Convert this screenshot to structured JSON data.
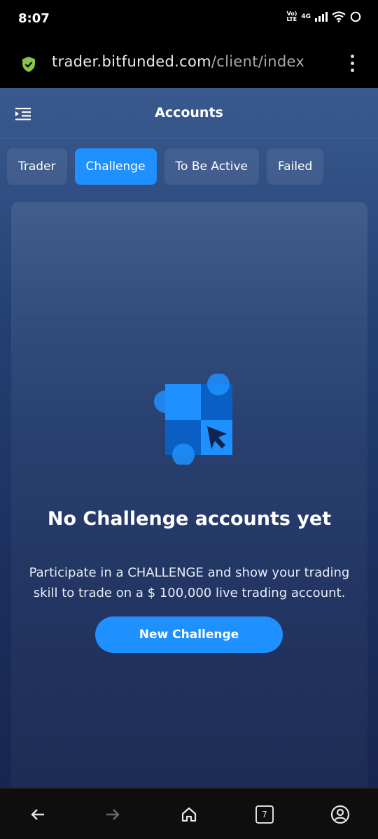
{
  "status_bar": {
    "time": "8:07",
    "volte_top": "Vo)",
    "volte_bottom": "LTE",
    "network": "4G"
  },
  "browser": {
    "url_domain": "trader.bitfunded.com",
    "url_path": "/client/index",
    "open_tabs": "7"
  },
  "header": {
    "title": "Accounts"
  },
  "tabs": [
    {
      "label": "Trader",
      "active": false
    },
    {
      "label": "Challenge",
      "active": true
    },
    {
      "label": "To Be Active",
      "active": false
    },
    {
      "label": "Failed",
      "active": false
    }
  ],
  "empty_state": {
    "title": "No Challenge accounts yet",
    "description": "Participate in a CHALLENGE and show your trading skill to trade on a $ 100,000 live trading account.",
    "button_label": "New Challenge"
  },
  "icons": {
    "lock": "shield-check-icon",
    "menu": "menu-indent-icon",
    "back": "back-arrow-icon",
    "forward": "forward-arrow-icon",
    "home": "home-icon",
    "tabs": "tabs-counter-icon",
    "profile": "profile-icon"
  },
  "colors": {
    "accent": "#1e90ff",
    "secure": "#8bc34a",
    "background_top": "#3a5a8f",
    "background_bottom": "#17254f"
  }
}
